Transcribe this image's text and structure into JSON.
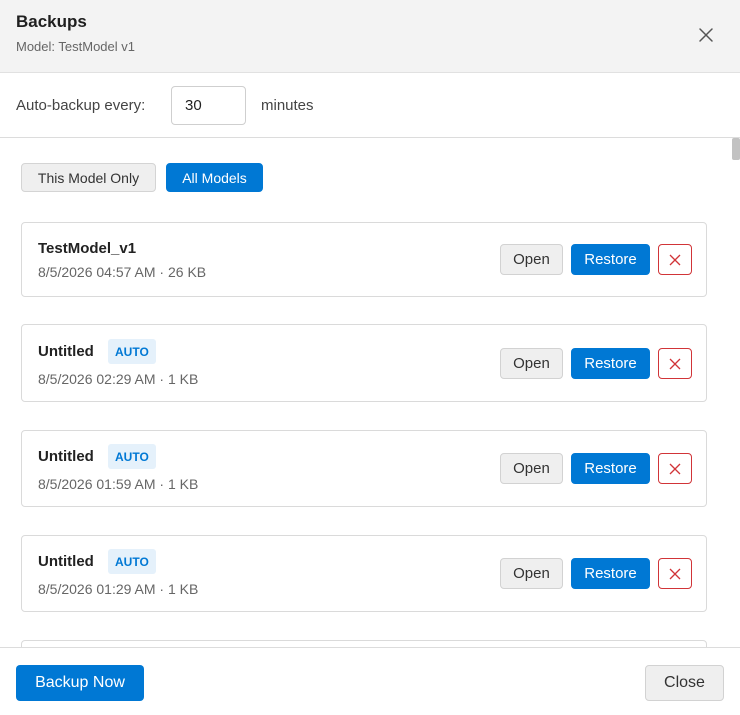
{
  "dialog": {
    "title": "Backups",
    "subtitle": "Model: TestModel v1"
  },
  "auto_backup": {
    "label": "Auto-backup every:",
    "value": "30",
    "unit": "minutes"
  },
  "filters": {
    "this_model": "This Model Only",
    "all_models": "All Models",
    "selected": "all_models"
  },
  "backups": [
    {
      "name": "TestModel_v1",
      "badge": "",
      "meta": "8/5/2026 04:57 AM · 26 KB"
    },
    {
      "name": "Untitled",
      "badge": "AUTO",
      "meta": "8/5/2026 02:29 AM · 1 KB"
    },
    {
      "name": "Untitled",
      "badge": "AUTO",
      "meta": "8/5/2026 01:59 AM · 1 KB"
    },
    {
      "name": "Untitled",
      "badge": "AUTO",
      "meta": "8/5/2026 01:29 AM · 1 KB"
    }
  ],
  "card_buttons": {
    "open": "Open",
    "restore": "Restore"
  },
  "footer": {
    "backup_now": "Backup Now",
    "close": "Close"
  },
  "colors": {
    "accent": "#0078d4",
    "danger": "#d13438",
    "badge_bg": "#e5f1fb"
  }
}
